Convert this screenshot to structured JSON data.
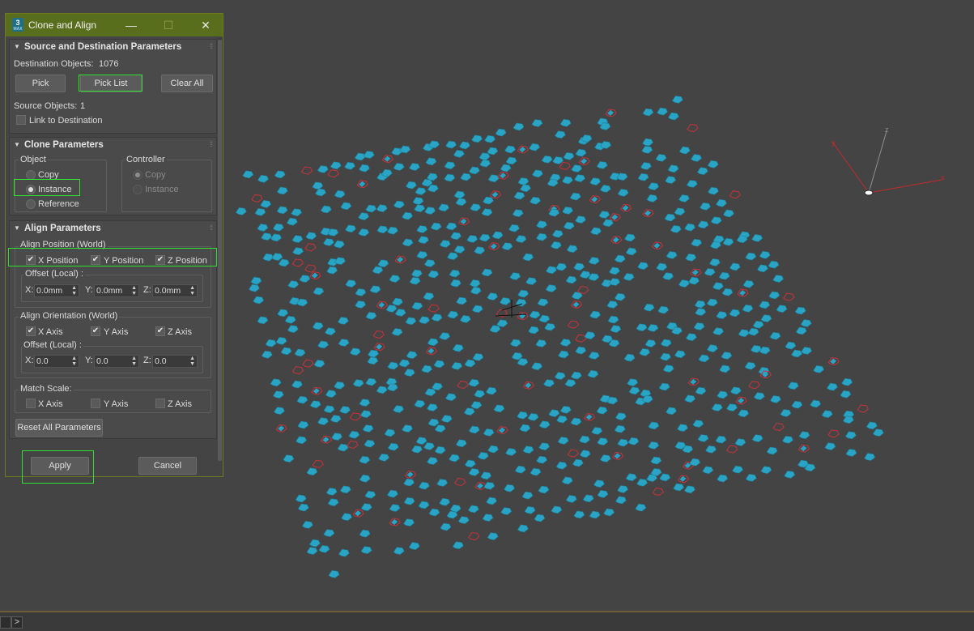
{
  "dialog": {
    "title": "Clone and Align",
    "icon_text": "3",
    "icon_subtext": "MAX",
    "minimize_glyph": "—",
    "maximize_glyph": "☐",
    "close_glyph": "✕"
  },
  "source_dest": {
    "title": "Source and Destination Parameters",
    "dest_label": "Destination Objects:",
    "dest_value": "1076",
    "pick_label": "Pick",
    "pick_list_label": "Pick List",
    "clear_all_label": "Clear All",
    "source_label": "Source Objects:",
    "source_value": "1",
    "link_label": "Link to Destination",
    "link_checked": false
  },
  "clone_params": {
    "title": "Clone Parameters",
    "object_group": "Object",
    "object_options": [
      "Copy",
      "Instance",
      "Reference"
    ],
    "object_selected": "Instance",
    "controller_group": "Controller",
    "controller_options": [
      "Copy",
      "Instance"
    ],
    "controller_selected": "Copy",
    "controller_enabled": false
  },
  "align_params": {
    "title": "Align Parameters",
    "position_group": "Align Position (World)",
    "x_position": "X Position",
    "y_position": "Y Position",
    "z_position": "Z Position",
    "position_checked": [
      true,
      true,
      true
    ],
    "offset_label": "Offset (Local) :",
    "pos_offset": {
      "x_label": "X:",
      "x": "0.0mm",
      "y_label": "Y:",
      "y": "0.0mm",
      "z_label": "Z:",
      "z": "0.0mm"
    },
    "orientation_group": "Align Orientation (World)",
    "x_axis": "X Axis",
    "y_axis": "Y Axis",
    "z_axis": "Z Axis",
    "orientation_checked": [
      true,
      true,
      true
    ],
    "rot_offset": {
      "x_label": "X:",
      "x": "0.0",
      "y_label": "Y:",
      "y": "0.0",
      "z_label": "Z:",
      "z": "0.0"
    },
    "match_scale_label": "Match Scale:",
    "scale_checked": [
      false,
      false,
      false
    ],
    "reset_label": "Reset All Parameters"
  },
  "footer": {
    "apply_label": "Apply",
    "cancel_label": "Cancel"
  },
  "viewport": {
    "object_color": "#2aa4c4",
    "highlight_color": "#c8323c",
    "gizmo_labels": {
      "x": "x",
      "y": "y",
      "z": "z"
    }
  },
  "statusbar": {
    "expand_glyph": ">"
  }
}
